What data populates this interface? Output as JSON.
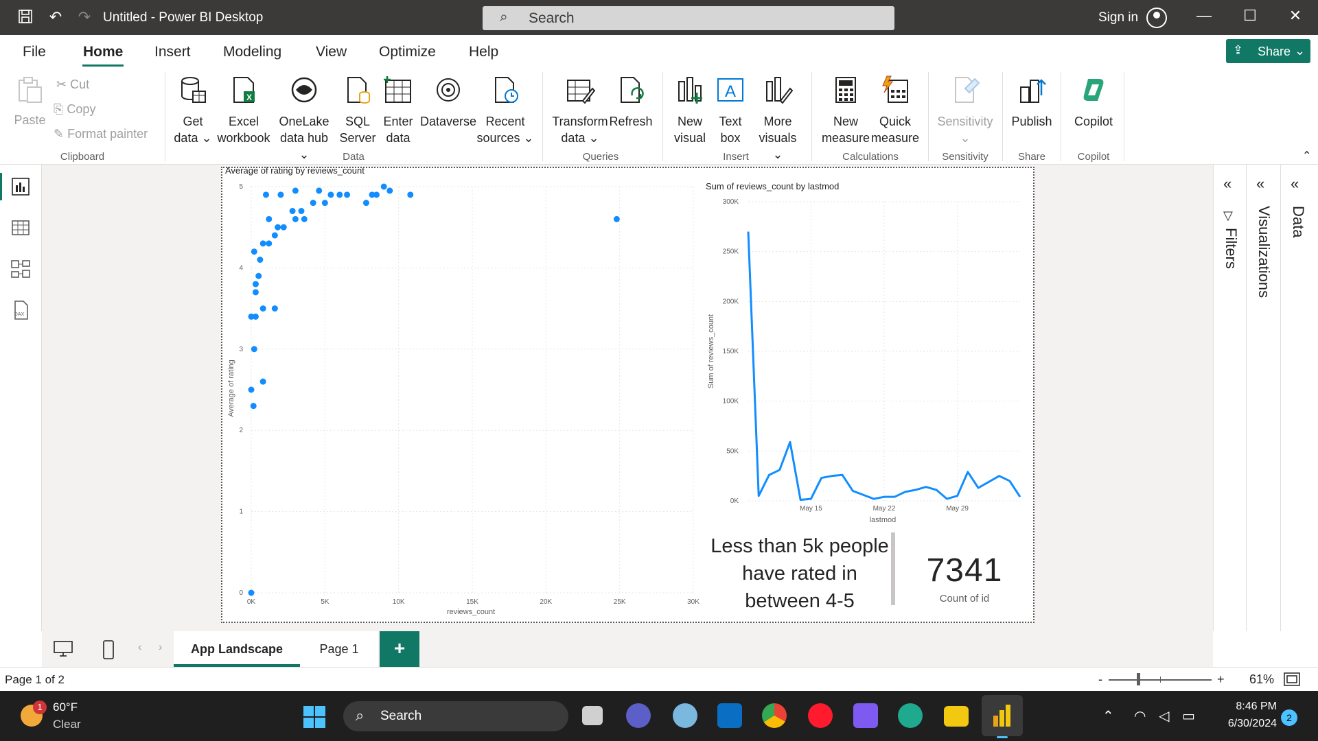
{
  "window": {
    "title": "Untitled - Power BI Desktop",
    "search_placeholder": "Search",
    "sign_in": "Sign in"
  },
  "menu": {
    "items": [
      "File",
      "Home",
      "Insert",
      "Modeling",
      "View",
      "Optimize",
      "Help"
    ],
    "active": "Home",
    "share_label": "Share"
  },
  "ribbon": {
    "clipboard": {
      "paste": "Paste",
      "cut": "Cut",
      "copy": "Copy",
      "format_painter": "Format painter",
      "group": "Clipboard"
    },
    "data": {
      "get_data": [
        "Get",
        "data"
      ],
      "excel": [
        "Excel",
        "workbook"
      ],
      "onelake": [
        "OneLake",
        "data hub"
      ],
      "sql": [
        "SQL",
        "Server"
      ],
      "enter": [
        "Enter",
        "data"
      ],
      "dataverse": "Dataverse",
      "recent": [
        "Recent",
        "sources"
      ],
      "group": "Data"
    },
    "queries": {
      "transform": [
        "Transform",
        "data"
      ],
      "refresh": "Refresh",
      "group": "Queries"
    },
    "insert": {
      "new_visual": [
        "New",
        "visual"
      ],
      "text_box": [
        "Text",
        "box"
      ],
      "more_visuals": [
        "More",
        "visuals"
      ],
      "group": "Insert"
    },
    "calculations": {
      "new_measure": [
        "New",
        "measure"
      ],
      "quick_measure": [
        "Quick",
        "measure"
      ],
      "group": "Calculations"
    },
    "sensitivity": {
      "label": "Sensitivity",
      "group": "Sensitivity"
    },
    "share": {
      "publish": "Publish",
      "group": "Share"
    },
    "copilot": {
      "label": "Copilot",
      "group": "Copilot"
    }
  },
  "report": {
    "scatter": {
      "title": "Average of rating by reviews_count",
      "xlabel": "reviews_count",
      "ylabel": "Average of rating",
      "xticks": [
        "0K",
        "5K",
        "10K",
        "15K",
        "20K",
        "25K",
        "30K"
      ],
      "yticks": [
        "0",
        "1",
        "2",
        "3",
        "4",
        "5"
      ]
    },
    "line": {
      "title": "Sum of reviews_count by lastmod",
      "xlabel": "lastmod",
      "ylabel": "Sum of reviews_count",
      "xticks": [
        "May 15",
        "May 22",
        "May 29"
      ],
      "yticks": [
        "0K",
        "50K",
        "100K",
        "150K",
        "200K",
        "250K",
        "300K"
      ]
    },
    "card_text": [
      "Less than 5k people",
      "have rated in",
      "between 4-5"
    ],
    "kpi": {
      "value": "7341",
      "label": "Count of id"
    }
  },
  "chart_data": [
    {
      "type": "scatter",
      "title": "Average of rating by reviews_count",
      "xlabel": "reviews_count",
      "ylabel": "Average of rating",
      "xlim": [
        0,
        30000
      ],
      "ylim": [
        0,
        5
      ],
      "points": [
        [
          0,
          0
        ],
        [
          150,
          2.3
        ],
        [
          800,
          2.6
        ],
        [
          0,
          2.5
        ],
        [
          200,
          3.0
        ],
        [
          0,
          3.4
        ],
        [
          300,
          3.4
        ],
        [
          800,
          3.5
        ],
        [
          1600,
          3.5
        ],
        [
          300,
          3.7
        ],
        [
          300,
          3.8
        ],
        [
          500,
          3.9
        ],
        [
          600,
          4.1
        ],
        [
          200,
          4.2
        ],
        [
          800,
          4.3
        ],
        [
          1200,
          4.3
        ],
        [
          1600,
          4.4
        ],
        [
          1800,
          4.5
        ],
        [
          2200,
          4.5
        ],
        [
          3000,
          4.6
        ],
        [
          3600,
          4.6
        ],
        [
          1200,
          4.6
        ],
        [
          2800,
          4.7
        ],
        [
          3400,
          4.7
        ],
        [
          4200,
          4.8
        ],
        [
          5000,
          4.8
        ],
        [
          5400,
          4.9
        ],
        [
          6000,
          4.9
        ],
        [
          7800,
          4.8
        ],
        [
          8200,
          4.9
        ],
        [
          9000,
          5.0
        ],
        [
          10800,
          4.9
        ],
        [
          9400,
          4.95
        ],
        [
          8500,
          4.9
        ],
        [
          6500,
          4.9
        ],
        [
          4600,
          4.95
        ],
        [
          3000,
          4.95
        ],
        [
          2000,
          4.9
        ],
        [
          1000,
          4.9
        ],
        [
          24800,
          4.6
        ]
      ]
    },
    {
      "type": "line",
      "title": "Sum of reviews_count by lastmod",
      "xlabel": "lastmod",
      "ylabel": "Sum of reviews_count",
      "ylim": [
        0,
        300000
      ],
      "x": [
        "May 9",
        "May 10",
        "May 11",
        "May 12",
        "May 13",
        "May 14",
        "May 15",
        "May 16",
        "May 17",
        "May 18",
        "May 19",
        "May 20",
        "May 21",
        "May 22",
        "May 23",
        "May 24",
        "May 25",
        "May 26",
        "May 27",
        "May 28",
        "May 29",
        "May 30",
        "May 31",
        "Jun 1",
        "Jun 2",
        "Jun 3"
      ],
      "values": [
        270000,
        5000,
        26000,
        31000,
        59000,
        1000,
        2000,
        23000,
        25000,
        26000,
        10000,
        6000,
        2000,
        4000,
        4000,
        9000,
        11000,
        14000,
        11000,
        2000,
        5000,
        29000,
        13000,
        19000,
        25000,
        20000,
        4000
      ]
    }
  ],
  "pages": {
    "tabs": [
      "App Landscape",
      "Page 1"
    ],
    "active": "App Landscape"
  },
  "panes": {
    "filters": "Filters",
    "visualizations": "Visualizations",
    "data": "Data"
  },
  "status": {
    "page": "Page 1 of 2",
    "zoom": "61%"
  },
  "taskbar": {
    "temp": "60°F",
    "condition": "Clear",
    "weather_badge": "1",
    "search": "Search",
    "time": "8:46 PM",
    "date": "6/30/2024",
    "notifications": "2"
  },
  "colors": {
    "accent": "#117865",
    "data": "#118dff",
    "titlebar": "#3b3a39"
  }
}
